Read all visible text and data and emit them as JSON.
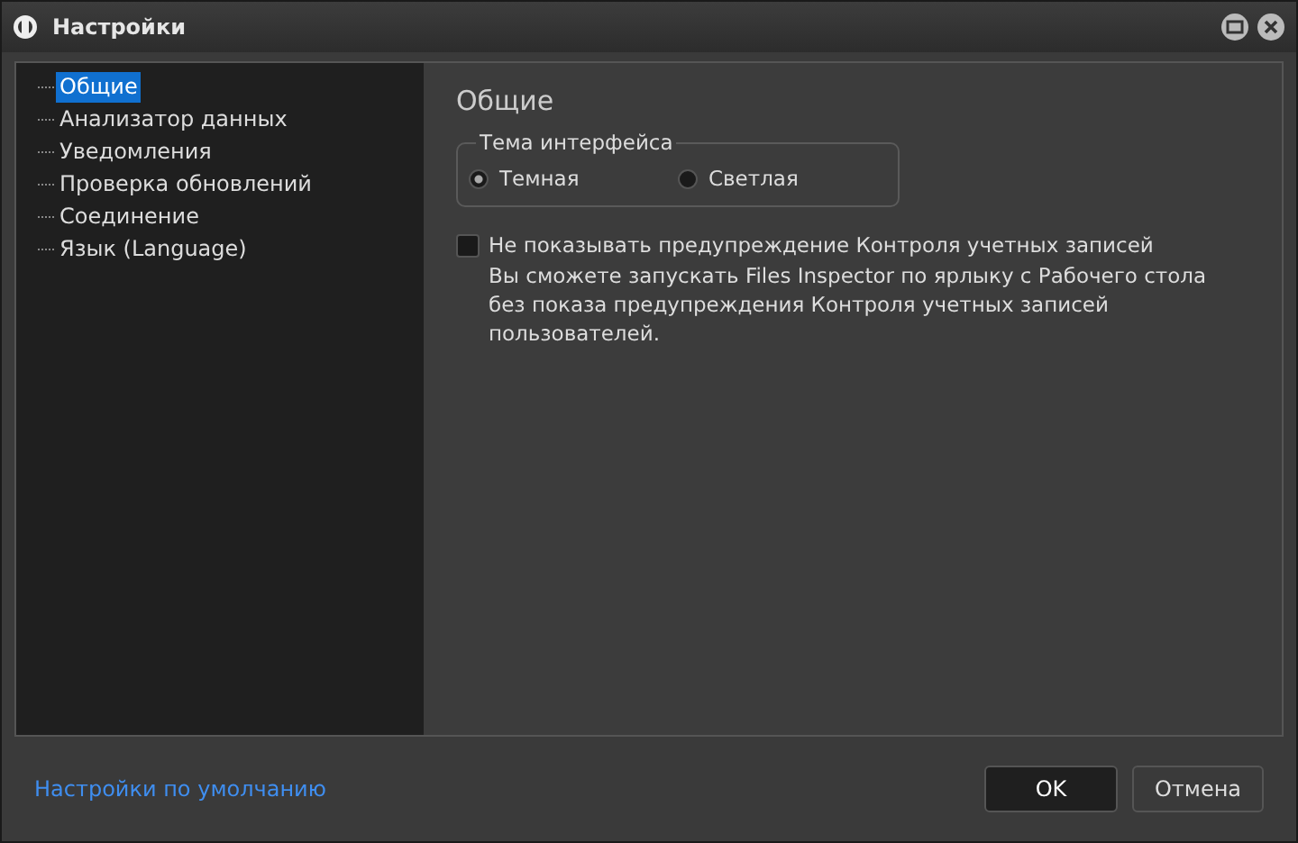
{
  "window": {
    "title": "Настройки"
  },
  "tree": [
    {
      "label": "Общие",
      "selected": true
    },
    {
      "label": "Анализатор данных",
      "selected": false
    },
    {
      "label": "Уведомления",
      "selected": false
    },
    {
      "label": "Проверка обновлений",
      "selected": false
    },
    {
      "label": "Соединение",
      "selected": false
    },
    {
      "label": "Язык (Language)",
      "selected": false
    }
  ],
  "page": {
    "heading": "Общие",
    "theme": {
      "legend": "Тема интерфейса",
      "options": [
        {
          "label": "Темная",
          "selected": true
        },
        {
          "label": "Светлая",
          "selected": false
        }
      ]
    },
    "uac": {
      "label": "Не показывать предупреждение Контроля учетных записей",
      "checked": false,
      "description": "Вы сможете запускать Files Inspector по ярлыку с Рабочего стола без показа предупреждения Контроля учетных записей пользователей."
    }
  },
  "footer": {
    "link": "Настройки по умолчанию",
    "buttons": [
      {
        "label": "OK",
        "kind": "primary"
      },
      {
        "label": "Отмена",
        "kind": "secondary"
      }
    ]
  }
}
